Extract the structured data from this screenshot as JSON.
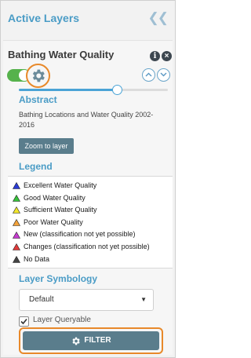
{
  "panel": {
    "title": "Active Layers"
  },
  "layer": {
    "title": "Bathing Water Quality",
    "visible": true,
    "opacity_fraction": 0.66
  },
  "abstract": {
    "heading": "Abstract",
    "text": "Bathing Locations and Water Quality 2002-2016",
    "zoom_label": "Zoom to layer"
  },
  "legend": {
    "heading": "Legend",
    "items": [
      {
        "label": "Excellent Water Quality",
        "color": "#2b3bd6"
      },
      {
        "label": "Good Water Quality",
        "color": "#36c23a"
      },
      {
        "label": "Sufficient Water Quality",
        "color": "#f2e62a"
      },
      {
        "label": "Poor Water Quality",
        "color": "#f3a23a"
      },
      {
        "label": "New (classification not yet possible)",
        "color": "#c63bd0"
      },
      {
        "label": "Changes (classification not yet possible)",
        "color": "#e23a3a"
      },
      {
        "label": "No Data",
        "color": "#444444"
      }
    ]
  },
  "symbology": {
    "heading": "Layer Symbology",
    "selected": "Default"
  },
  "queryable": {
    "label": "Layer Queryable",
    "checked": true
  },
  "filter": {
    "label": "FILTER"
  },
  "icons": {
    "collapse": "double-chevron-left-icon",
    "info": "info-icon",
    "close": "close-icon",
    "settings": "gear-icon",
    "move_up": "chevron-up-icon",
    "move_down": "chevron-down-icon",
    "filter": "gear-icon"
  },
  "colors": {
    "accent": "#4a9cc6",
    "highlight": "#e8892a",
    "button": "#5a7d8c",
    "toggle_on": "#56b24c"
  }
}
